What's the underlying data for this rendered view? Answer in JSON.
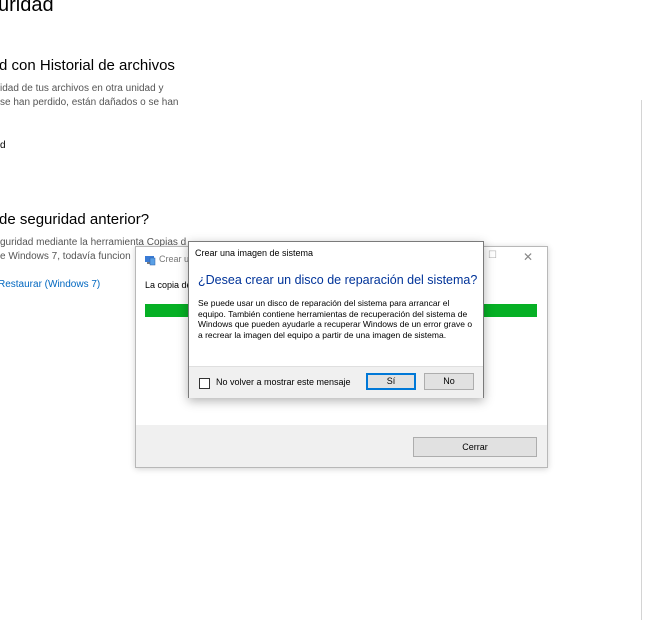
{
  "page": {
    "title": "uridad",
    "section1": {
      "heading": "d con Historial de archivos",
      "desc_line1": "idad de tus archivos en otra unidad y",
      "desc_line2": "se han perdido, están dañados o se han",
      "fragment": "d"
    },
    "section2": {
      "heading": "de seguridad anterior?",
      "desc_line1": "guridad mediante la herramienta Copias d",
      "desc_line2": "e Windows 7, todavía funcion",
      "link": "Restaurar (Windows 7)"
    }
  },
  "backup_window": {
    "title": "Crear u",
    "body_text": "La copia de",
    "progress_percent": 100,
    "close_button": "Cerrar",
    "colors": {
      "progress": "#06b025"
    }
  },
  "dialog": {
    "title": "Crear una imagen de sistema",
    "heading": "¿Desea crear un disco de reparación del sistema?",
    "body": "Se puede usar un disco de reparación del sistema para arrancar el equipo. También contiene herramientas de recuperación del sistema de Windows que pueden ayudarle a recuperar Windows de un error grave o a recrear la imagen del equipo a partir de una imagen de sistema.",
    "checkbox_label": "No volver a mostrar este mensaje",
    "checkbox_checked": false,
    "yes_button": "Sí",
    "no_button": "No",
    "colors": {
      "heading": "#003399",
      "default_button_border": "#0078d7"
    }
  },
  "icons": [
    "window-backup-icon",
    "maximize-icon",
    "close-icon"
  ]
}
